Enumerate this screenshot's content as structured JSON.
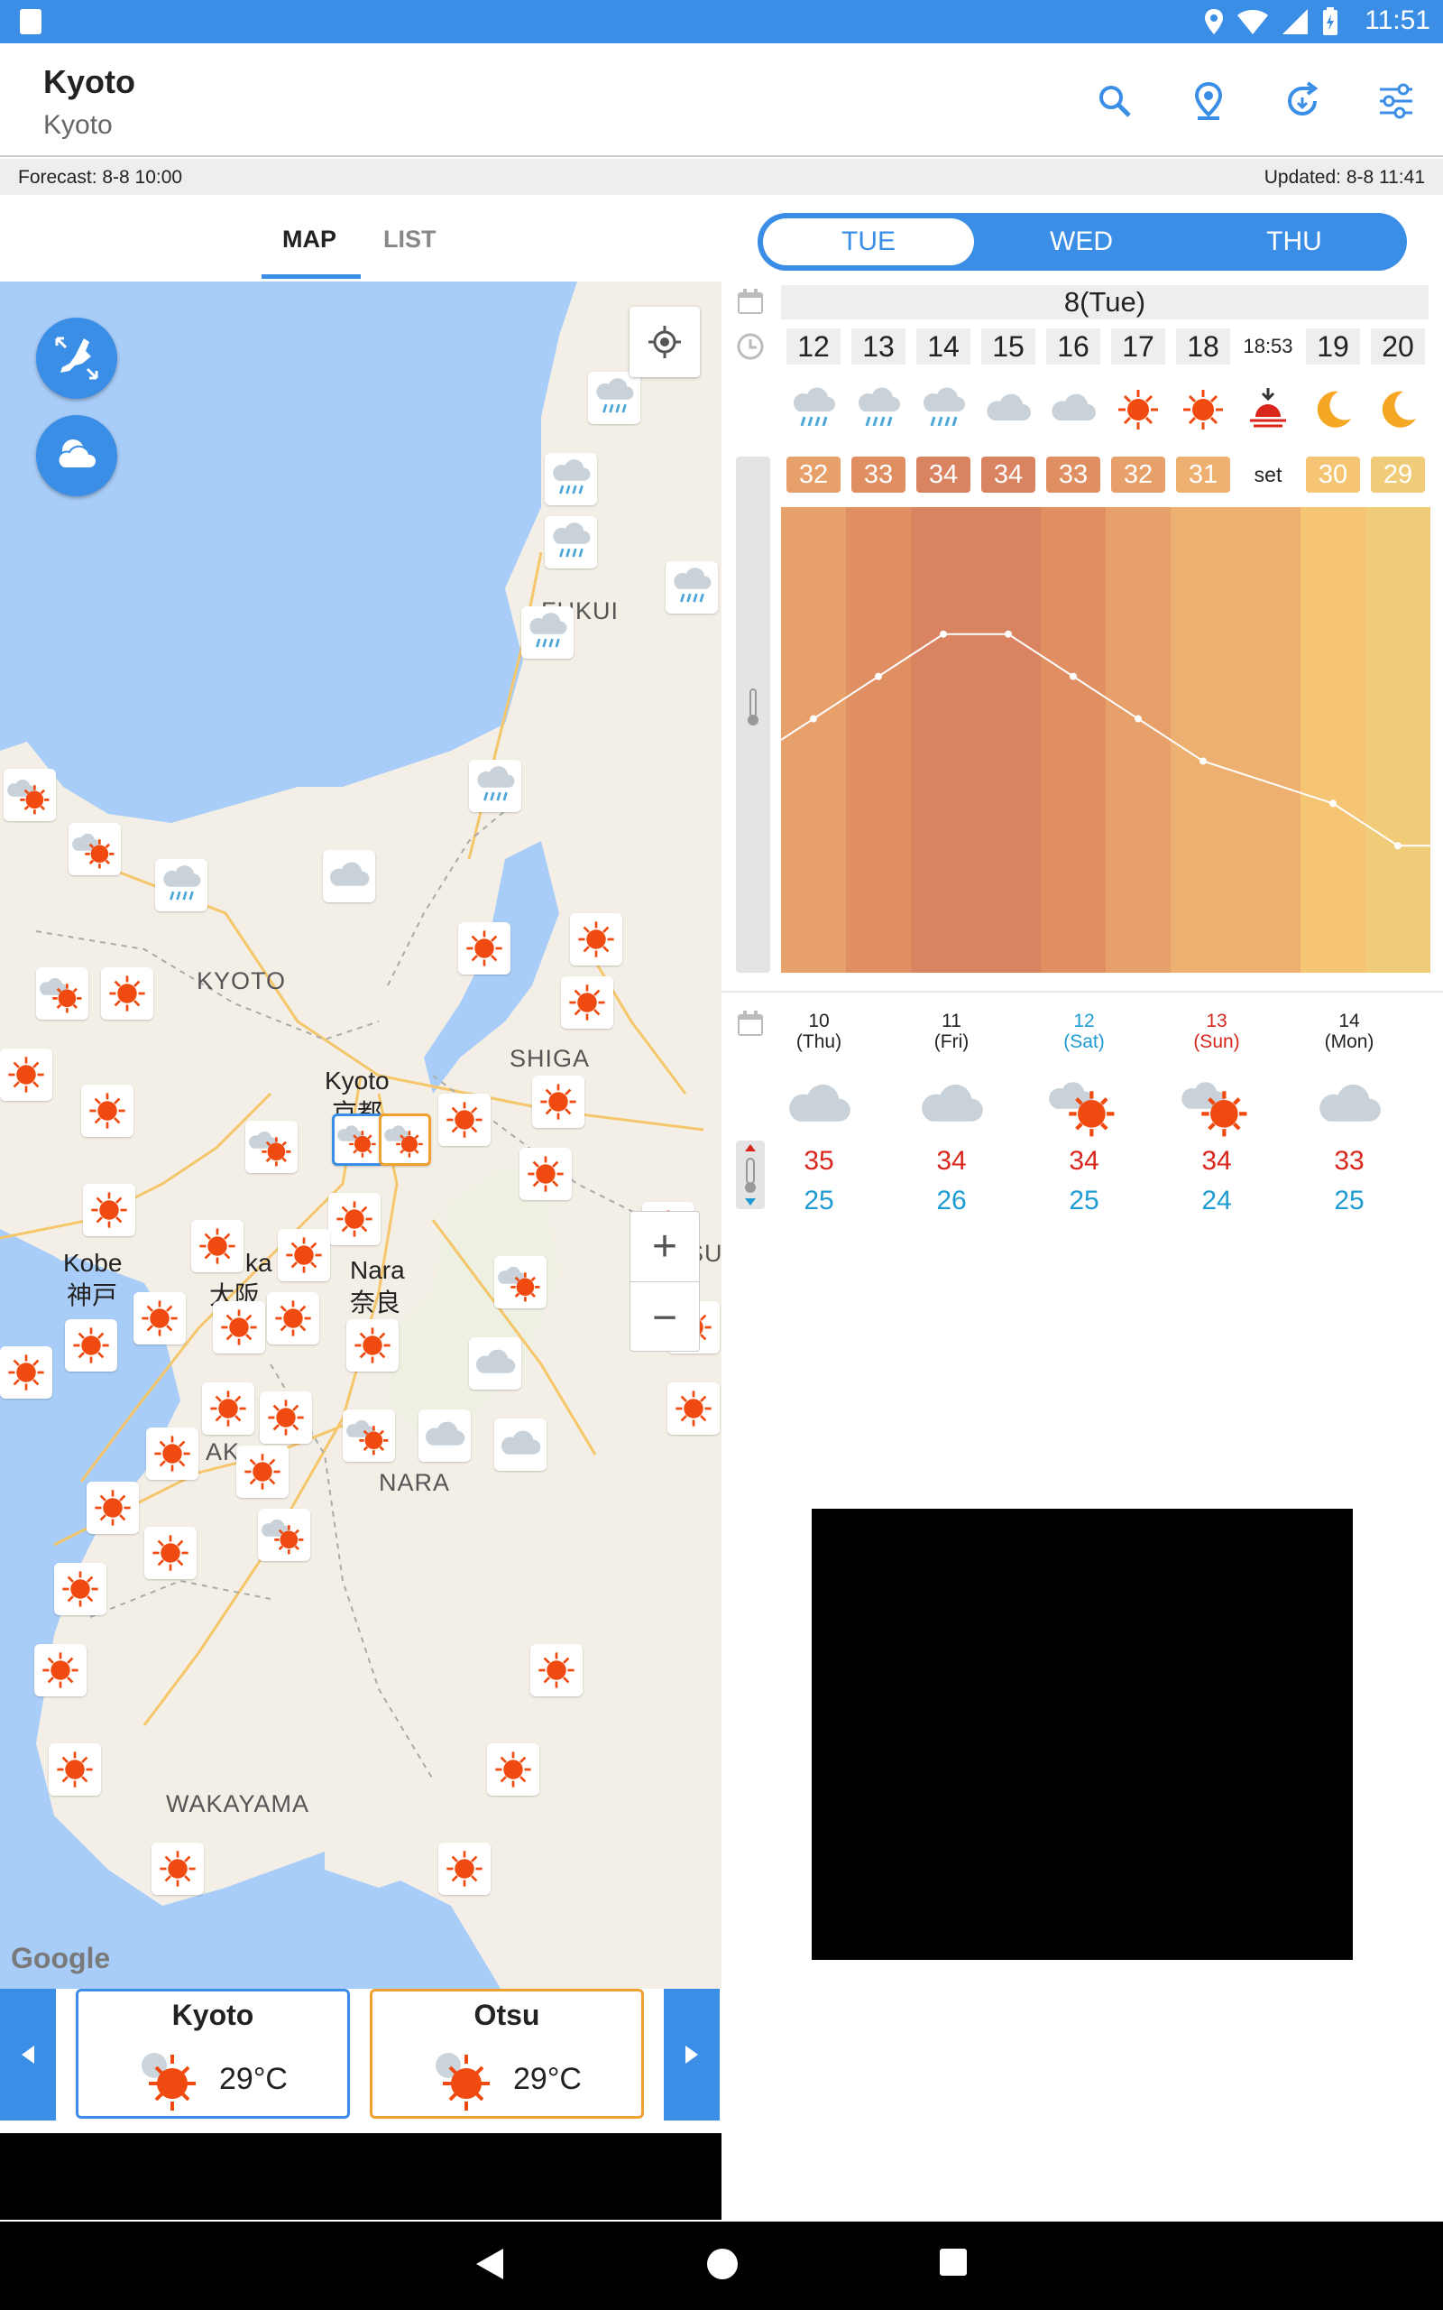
{
  "status": {
    "time": "11:51"
  },
  "app": {
    "title": "Kyoto",
    "subtitle": "Kyoto"
  },
  "icons": {
    "search": "search-icon",
    "location": "location-pin-icon",
    "refresh": "refresh-icon",
    "settings": "settings-sliders-icon"
  },
  "info": {
    "forecast": "Forecast: 8-8 10:00",
    "updated": "Updated: 8-8 11:41"
  },
  "map_tabs": {
    "map": "MAP",
    "list": "LIST"
  },
  "map": {
    "labels": {
      "fukui": "FUKUI",
      "kyoto_pref": "KYOTO",
      "shiga": "SHIGA",
      "nara_pref": "NARA",
      "wakayama": "WAKAYAMA",
      "osaka_pref": "AK",
      "mie": "SU"
    },
    "cities": {
      "kyoto": "Kyoto",
      "kyoto_jp": "京都",
      "kobe": "Kobe",
      "kobe_jp": "神戸",
      "osaka": "ka",
      "osaka_jp": "大阪",
      "nara": "Nara",
      "nara_jp": "奈良"
    },
    "google": "Google",
    "zoom_in": "+",
    "zoom_out": "−"
  },
  "cards": [
    {
      "name": "Kyoto",
      "temp": "29°C",
      "border": "#3a8ee6"
    },
    {
      "name": "Otsu",
      "temp": "29°C",
      "border": "#f0a030"
    }
  ],
  "day_tabs": [
    "TUE",
    "WED",
    "THU"
  ],
  "hourly": {
    "date": "8(Tue)",
    "hours": [
      "12",
      "13",
      "14",
      "15",
      "16",
      "17",
      "18",
      "18:53",
      "19",
      "20"
    ],
    "weather": [
      "rain",
      "rain",
      "rain",
      "cloud",
      "cloud",
      "sun",
      "sun",
      "sunset",
      "moon",
      "moon"
    ],
    "temps": [
      "32",
      "33",
      "34",
      "34",
      "33",
      "32",
      "31",
      "set",
      "30",
      "29"
    ],
    "temp_values": [
      32,
      33,
      34,
      34,
      33,
      32,
      31,
      null,
      30,
      29
    ],
    "colors": [
      "#e8a06a",
      "#e08f62",
      "#d98360",
      "#d98360",
      "#e08f62",
      "#e8a06a",
      "#eeb070",
      "",
      "#f6c574",
      "#f0cb78"
    ]
  },
  "weekly": [
    {
      "day": "10",
      "dow": "(Thu)",
      "icon": "cloud",
      "hi": "35",
      "lo": "25",
      "color": "#222222"
    },
    {
      "day": "11",
      "dow": "(Fri)",
      "icon": "cloud",
      "hi": "34",
      "lo": "26",
      "color": "#222222"
    },
    {
      "day": "12",
      "dow": "(Sat)",
      "icon": "sun-cloud",
      "hi": "34",
      "lo": "25",
      "color": "#1e9bd2"
    },
    {
      "day": "13",
      "dow": "(Sun)",
      "icon": "sun-cloud",
      "hi": "34",
      "lo": "24",
      "color": "#d9261c"
    },
    {
      "day": "14",
      "dow": "(Mon)",
      "icon": "cloud",
      "hi": "33",
      "lo": "25",
      "color": "#222222"
    }
  ]
}
